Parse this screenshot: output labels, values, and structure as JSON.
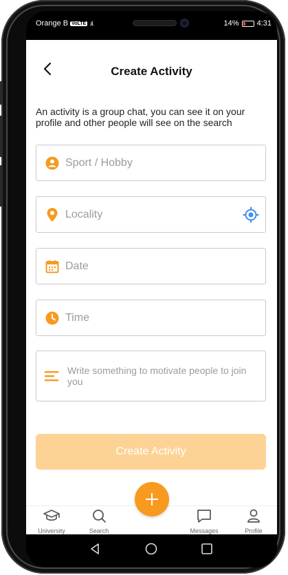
{
  "status_bar": {
    "carrier": "Orange B",
    "network_badge": "VoLTE",
    "signal": ".ıl.",
    "battery": "14%",
    "time": "4:31"
  },
  "header": {
    "back_icon": "chevron-left-icon",
    "title": "Create Activity"
  },
  "description": "An activity is a group chat, you can see it on your profile and other people will see on the search",
  "form": {
    "sport_placeholder": "Sport / Hobby",
    "locality_placeholder": "Locality",
    "date_placeholder": "Date",
    "time_placeholder": "Time",
    "message_placeholder": "Write something to motivate people to join you",
    "submit_label": "Create Activity"
  },
  "colors": {
    "accent": "#f79a1f",
    "button_disabled": "#fcd394",
    "locate_icon": "#3d8ef2"
  },
  "nav": {
    "items": [
      {
        "label": "University",
        "icon": "graduation-cap-icon"
      },
      {
        "label": "Search",
        "icon": "search-icon"
      },
      {
        "label": "Messages",
        "icon": "chat-bubble-icon"
      },
      {
        "label": "Profile",
        "icon": "user-icon"
      }
    ],
    "fab_icon": "plus-icon"
  },
  "system_nav": [
    "back-triangle-icon",
    "home-circle-icon",
    "recents-square-icon"
  ]
}
